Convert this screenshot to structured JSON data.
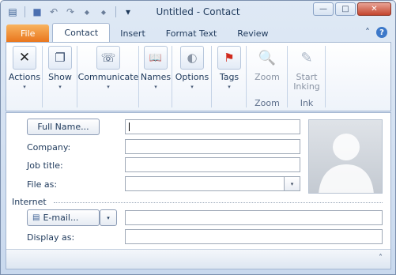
{
  "window": {
    "title": "Untitled  -  Contact",
    "controls": {
      "minimize": "—",
      "maximize": "□",
      "close": "✕"
    }
  },
  "qat": {
    "icons": [
      "contact-card-icon",
      "save-icon",
      "undo-icon",
      "redo-icon",
      "up-arrow-icon",
      "down-arrow-icon",
      "customize-icon"
    ],
    "glyphs": {
      "app": "▤",
      "save": "■",
      "undo": "↶",
      "redo": "↷",
      "up": "◆",
      "down": "◆",
      "customize": "▾"
    }
  },
  "tabs": {
    "file": "File",
    "items": [
      "Contact",
      "Insert",
      "Format Text",
      "Review"
    ],
    "active": "Contact",
    "right": {
      "minimize_ribbon": "˄",
      "help": "?"
    }
  },
  "ribbon": {
    "groups": [
      {
        "label": "Actions",
        "icon": "close-x-icon",
        "glyph": "✕",
        "arrow": "▾"
      },
      {
        "label": "Show",
        "icon": "pages-icon",
        "glyph": "❐",
        "arrow": "▾"
      },
      {
        "label": "Communicate",
        "icon": "communicate-icon",
        "glyph": "☏",
        "arrow": "▾"
      },
      {
        "label": "Names",
        "icon": "address-book-icon",
        "glyph": "📖",
        "arrow": "▾"
      },
      {
        "label": "Options",
        "icon": "person-silhouette-icon",
        "glyph": "◐",
        "arrow": "▾"
      },
      {
        "label": "Tags",
        "icon": "flag-icon",
        "glyph": "⚑",
        "arrow": "▾"
      }
    ],
    "zoom": {
      "button": "Zoom",
      "group": "Zoom",
      "glyph": "🔍"
    },
    "ink": {
      "button1": "Start",
      "button2": "Inking",
      "group": "Ink",
      "glyph": "✎"
    }
  },
  "form": {
    "full_name_button": "Full Name...",
    "company_label": "Company:",
    "job_title_label": "Job title:",
    "file_as_label": "File as:",
    "internet_label": "Internet",
    "email_button": "E-mail...",
    "display_as_label": "Display as:",
    "values": {
      "full_name": "",
      "company": "",
      "job_title": "",
      "file_as": "",
      "email": "",
      "display_as": ""
    },
    "dropdown_arrow": "▾",
    "collapse": "˄"
  }
}
